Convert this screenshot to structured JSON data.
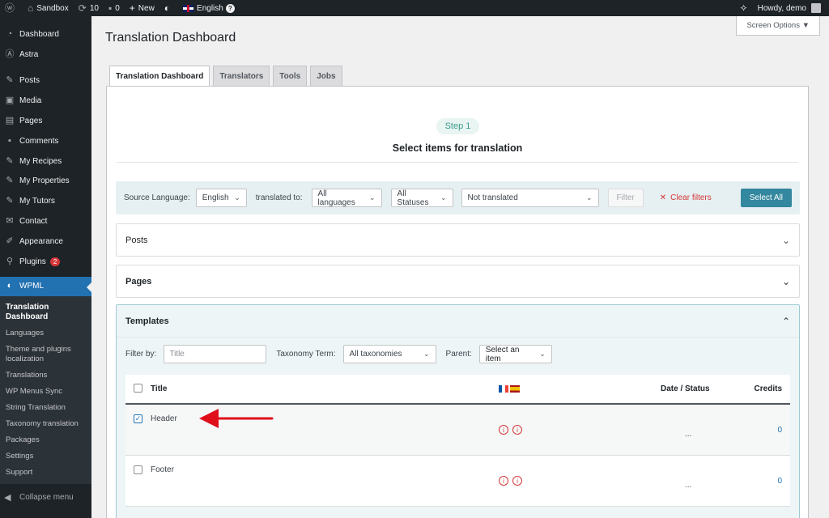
{
  "adminbar": {
    "site": "Sandbox",
    "updates": "10",
    "comments": "0",
    "new": "New",
    "language": "English",
    "howdy": "Howdy, demo"
  },
  "sidebar": {
    "items": [
      {
        "label": "Dashboard",
        "icon": "dashboard-icon"
      },
      {
        "label": "Astra",
        "icon": "astra-icon"
      },
      {
        "label": "Posts",
        "icon": "pin-icon"
      },
      {
        "label": "Media",
        "icon": "media-icon"
      },
      {
        "label": "Pages",
        "icon": "pages-icon"
      },
      {
        "label": "Comments",
        "icon": "comments-icon"
      },
      {
        "label": "My Recipes",
        "icon": "pin-icon"
      },
      {
        "label": "My Properties",
        "icon": "pin-icon"
      },
      {
        "label": "My Tutors",
        "icon": "pin-icon"
      },
      {
        "label": "Contact",
        "icon": "mail-icon"
      },
      {
        "label": "Appearance",
        "icon": "brush-icon"
      },
      {
        "label": "Plugins",
        "icon": "plugin-icon",
        "badge": "2"
      },
      {
        "label": "WPML",
        "icon": "wpml-icon"
      }
    ],
    "submenu": [
      "Translation Dashboard",
      "Languages",
      "Theme and plugins localization",
      "Translations",
      "WP Menus Sync",
      "String Translation",
      "Taxonomy translation",
      "Packages",
      "Settings",
      "Support"
    ],
    "collapse": "Collapse menu"
  },
  "header": {
    "screen_options": "Screen Options",
    "title": "Translation Dashboard"
  },
  "tabs": [
    "Translation Dashboard",
    "Translators",
    "Tools",
    "Jobs"
  ],
  "step": {
    "pill": "Step 1",
    "title": "Select items for translation"
  },
  "filters": {
    "source_label": "Source Language:",
    "source_value": "English",
    "translated_label": "translated to:",
    "languages": "All languages",
    "statuses": "All Statuses",
    "translation_state": "Not translated",
    "filter_btn": "Filter",
    "clear_btn": "Clear filters",
    "select_all": "Select All"
  },
  "sections": {
    "posts": "Posts",
    "pages": "Pages",
    "templates": "Templates"
  },
  "template_filters": {
    "filter_by": "Filter by:",
    "title_placeholder": "Title",
    "taxonomy_label": "Taxonomy Term:",
    "taxonomy_value": "All taxonomies",
    "parent_label": "Parent:",
    "parent_value": "Select an item"
  },
  "table": {
    "headers": {
      "title": "Title",
      "date": "Date / Status",
      "credits": "Credits"
    },
    "rows": [
      {
        "title": "Header",
        "checked": true,
        "date": "...",
        "credits": "0"
      },
      {
        "title": "Footer",
        "checked": false,
        "date": "...",
        "credits": "0"
      }
    ]
  },
  "colors": {
    "accent": "#2271b1",
    "arrow": "#e0101b",
    "primary_btn": "#33879e"
  }
}
